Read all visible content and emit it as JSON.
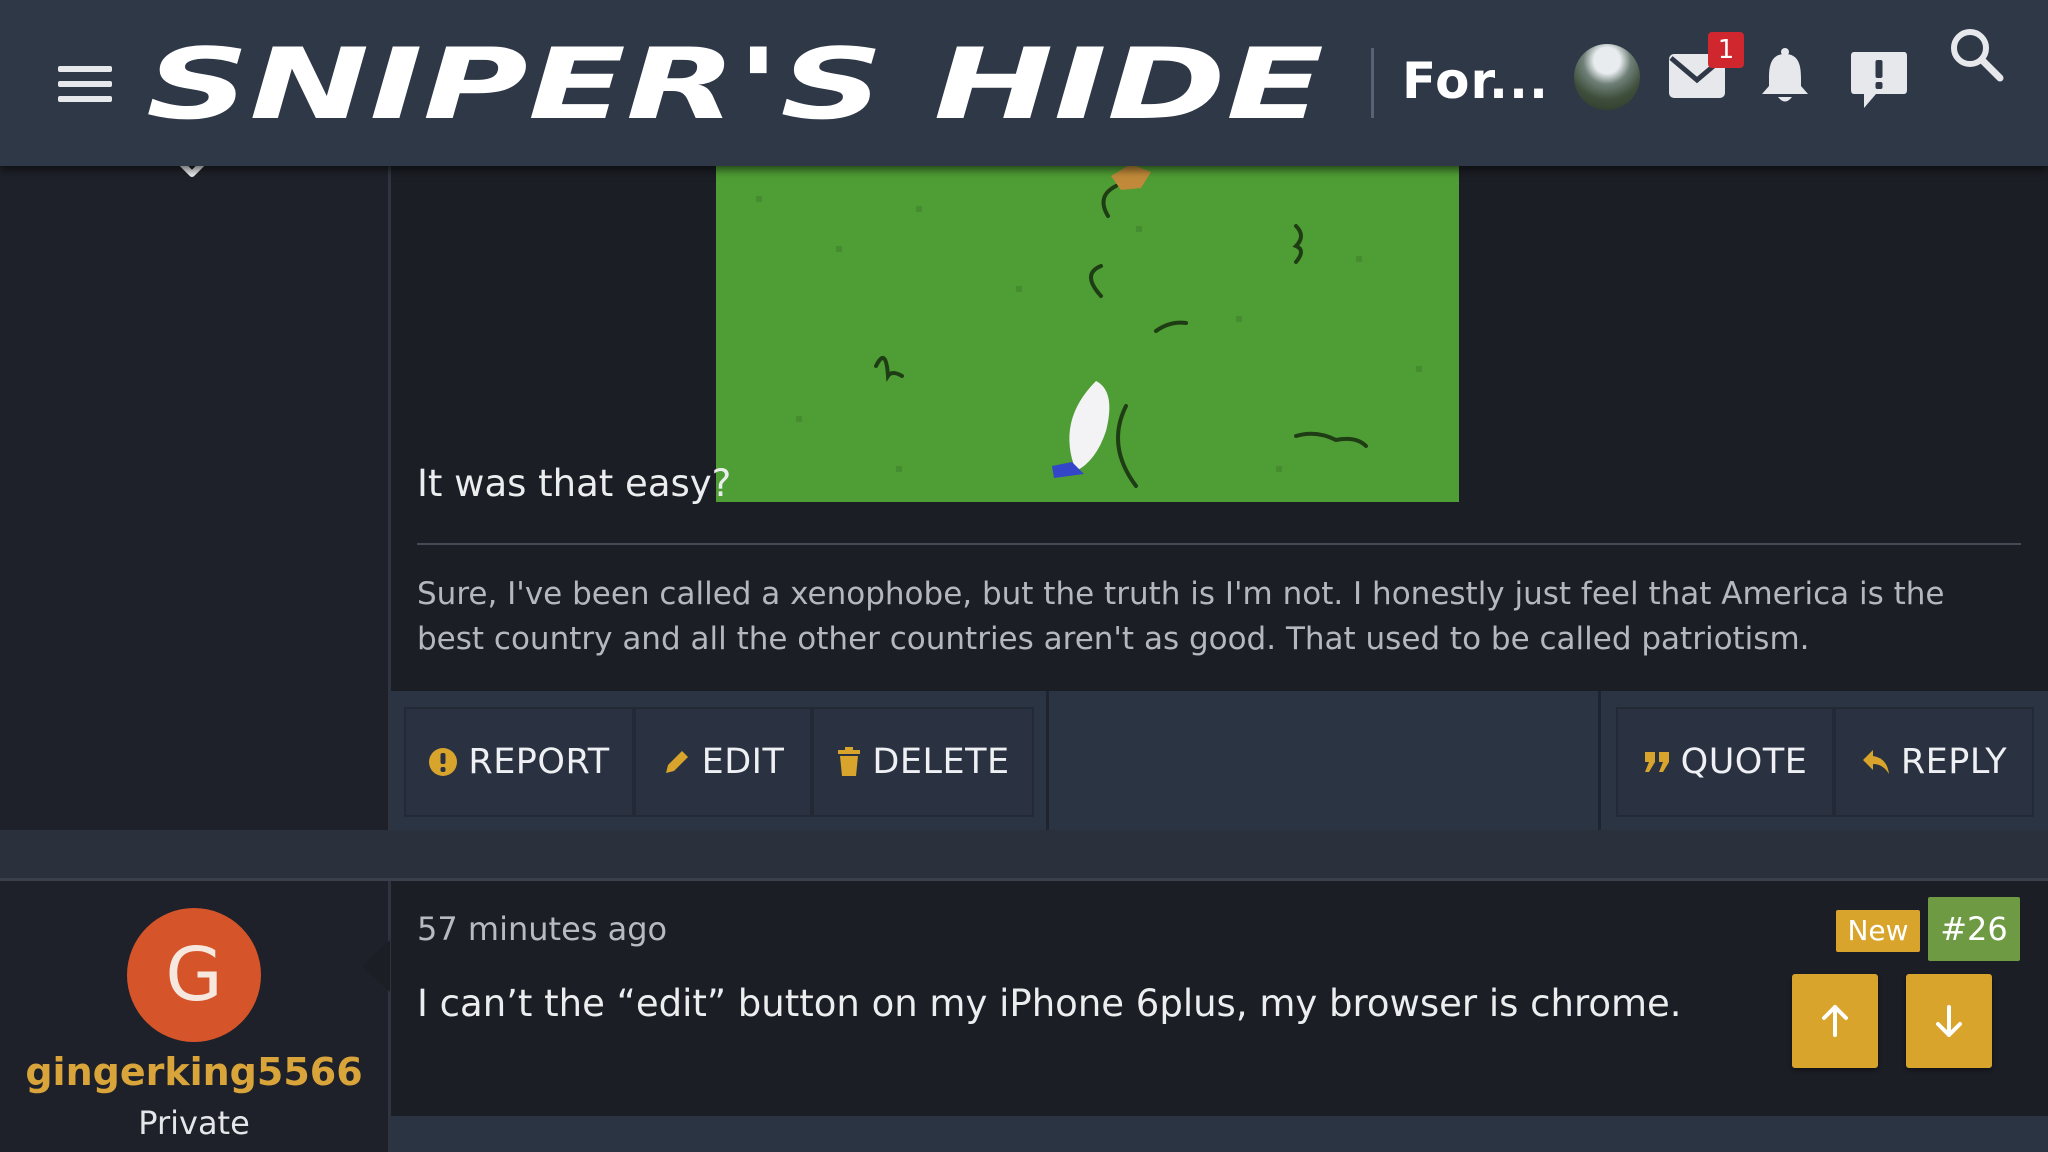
{
  "header": {
    "site_name": "SNIPER'S HIDE",
    "section_title": "For...",
    "unread_messages": "1"
  },
  "post": {
    "body_text": "It was that easy?",
    "signature": "Sure, I've been called a xenophobe, but the truth is I'm not. I honestly just feel that America is the best country and all the other countries aren't as good. That used to be called patriotism.",
    "actions": {
      "report": "REPORT",
      "edit": "EDIT",
      "delete": "DELETE",
      "quote": "QUOTE",
      "reply": "REPLY"
    }
  },
  "next_post": {
    "author": {
      "initial": "G",
      "username": "gingerking5566",
      "title": "Private"
    },
    "timestamp": "57 minutes ago",
    "badge": "New",
    "number": "#26",
    "body_text": "I can’t the “edit” button on my iPhone 6plus, my browser is chrome."
  },
  "colors": {
    "header_bg": "#2f3847",
    "accent_gold": "#d8a42c",
    "post_number_green": "#6f9a44",
    "avatar_orange": "#d5542a",
    "notification_red": "#d0272f"
  },
  "icons": [
    "hamburger-icon",
    "mail-icon",
    "bell-icon",
    "alert-icon",
    "search-icon",
    "report-icon",
    "pencil-icon",
    "trash-icon",
    "quote-icon",
    "reply-icon",
    "arrow-up-icon",
    "arrow-down-icon",
    "chevron-down-icon"
  ]
}
